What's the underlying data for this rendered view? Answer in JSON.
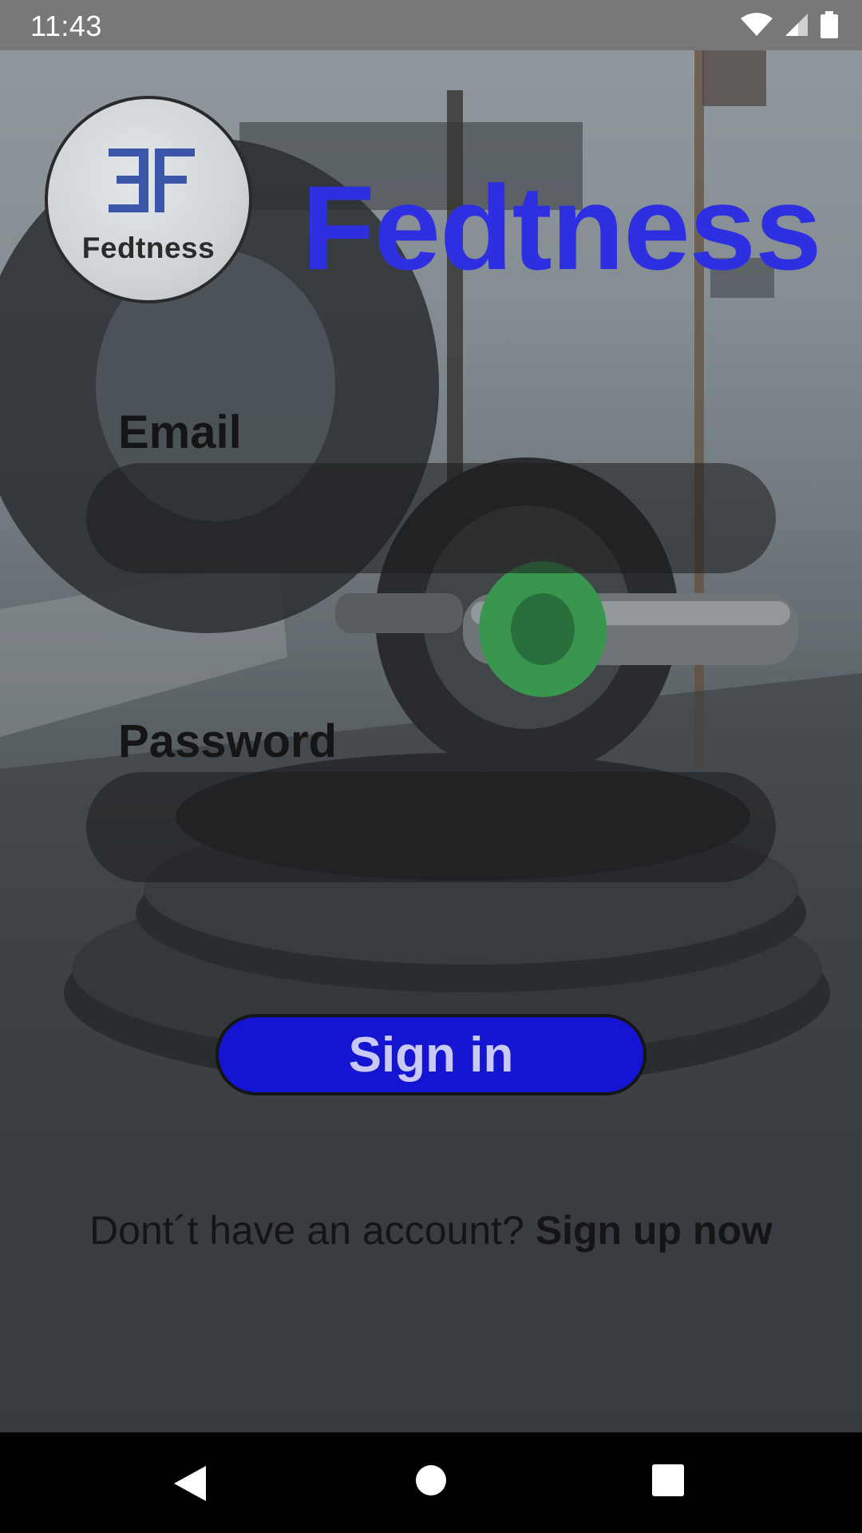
{
  "status_bar": {
    "time": "11:43",
    "icons": [
      "wifi-icon",
      "signal-icon",
      "battery-icon"
    ]
  },
  "header": {
    "logo_text": "Fedtness",
    "logo_mark": "ƎF",
    "title": "Fedtness",
    "title_color": "#2d2fe0"
  },
  "form": {
    "email_label": "Email",
    "email_value": "",
    "password_label": "Password",
    "password_value": "",
    "signin_label": "Sign in",
    "signin_color": "#1414d2"
  },
  "footer": {
    "prompt": "Dont´t have an account? ",
    "signup_link": "Sign up now"
  },
  "nav_bar": {
    "buttons": [
      "back-icon",
      "home-icon",
      "recents-icon"
    ]
  }
}
